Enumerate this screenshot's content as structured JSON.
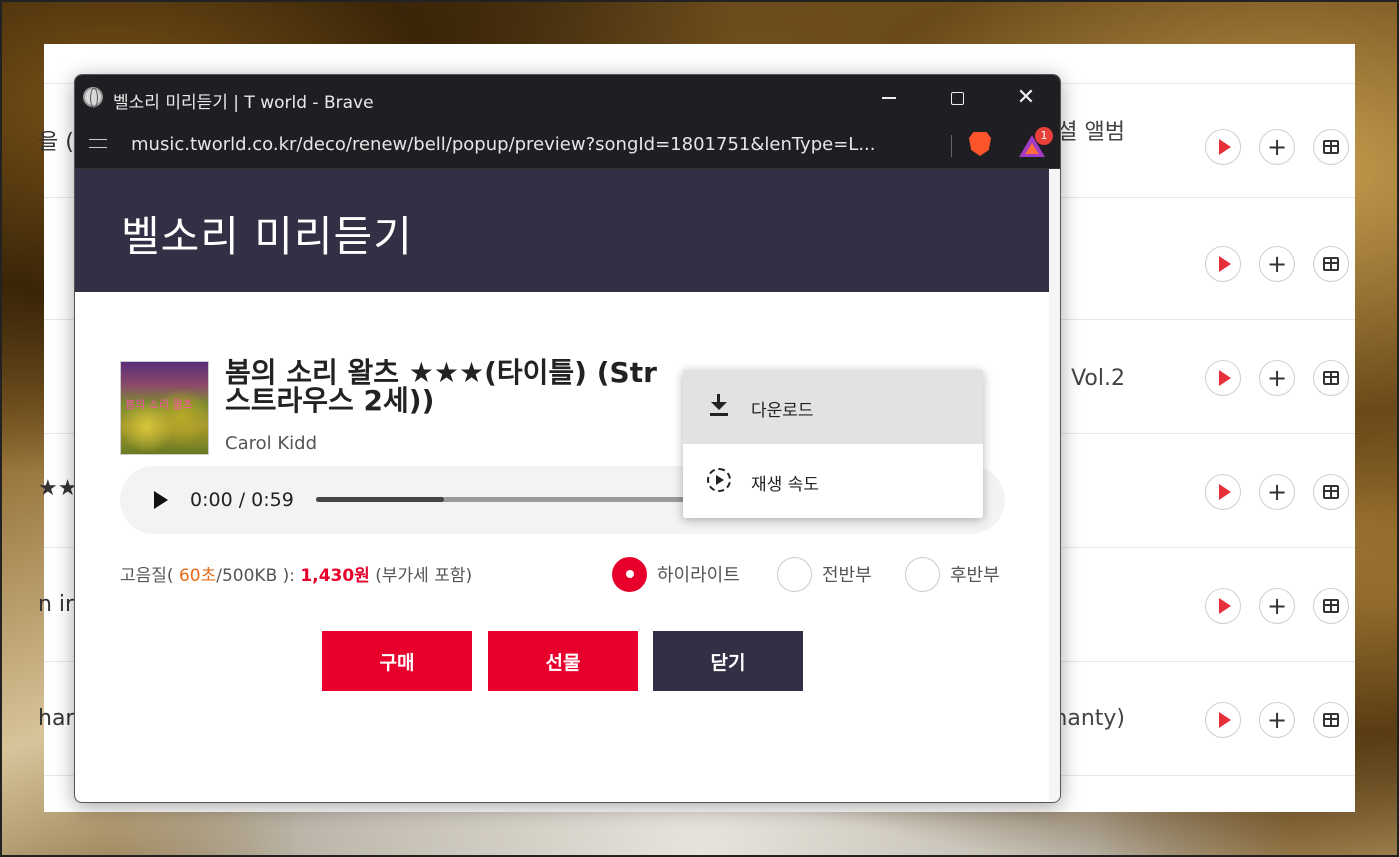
{
  "background_page": {
    "rows": [
      {
        "left": "을 (K",
        "right": "셜 앨범"
      },
      {
        "left": "",
        "right": ""
      },
      {
        "left": "",
        "right": "Vol.2"
      },
      {
        "left": "★★",
        "right": ""
      },
      {
        "left": "n in",
        "right": ""
      },
      {
        "left": "han",
        "right": "hanty)"
      }
    ],
    "colors": {
      "play_accent": "#e8303a"
    }
  },
  "window": {
    "title": "벨소리 미리듣기 | T world - Brave",
    "url": "music.tworld.co.kr/deco/renew/bell/popup/preview?songId=1801751&lenType=L...",
    "rewards_badge": "1"
  },
  "popup": {
    "header_title": "벨소리 미리듣기",
    "album_caption": "봄의 소리 왈츠",
    "song_title": "봄의 소리 왈츠 ★★★(타이틀) (Str",
    "song_title_line2": "스트라우스 2세))",
    "artist": "Carol Kidd",
    "player": {
      "time": "0:00 / 0:59",
      "progress": 0.32
    },
    "price": {
      "label_prefix": "고음질( ",
      "duration": "60초",
      "size": "/500KB ): ",
      "amount": "1,430원",
      "vat": " (부가세 포함)"
    },
    "radio_options": [
      {
        "label": "하이라이트",
        "checked": true
      },
      {
        "label": "전반부",
        "checked": false
      },
      {
        "label": "후반부",
        "checked": false
      }
    ],
    "buttons": {
      "buy": "구매",
      "gift": "선물",
      "close": "닫기"
    },
    "context_menu": {
      "download": "다운로드",
      "speed": "재생 속도"
    },
    "colors": {
      "header_bg": "#332f45",
      "primary_red": "#e8002d",
      "orange": "#e86a1a"
    }
  }
}
